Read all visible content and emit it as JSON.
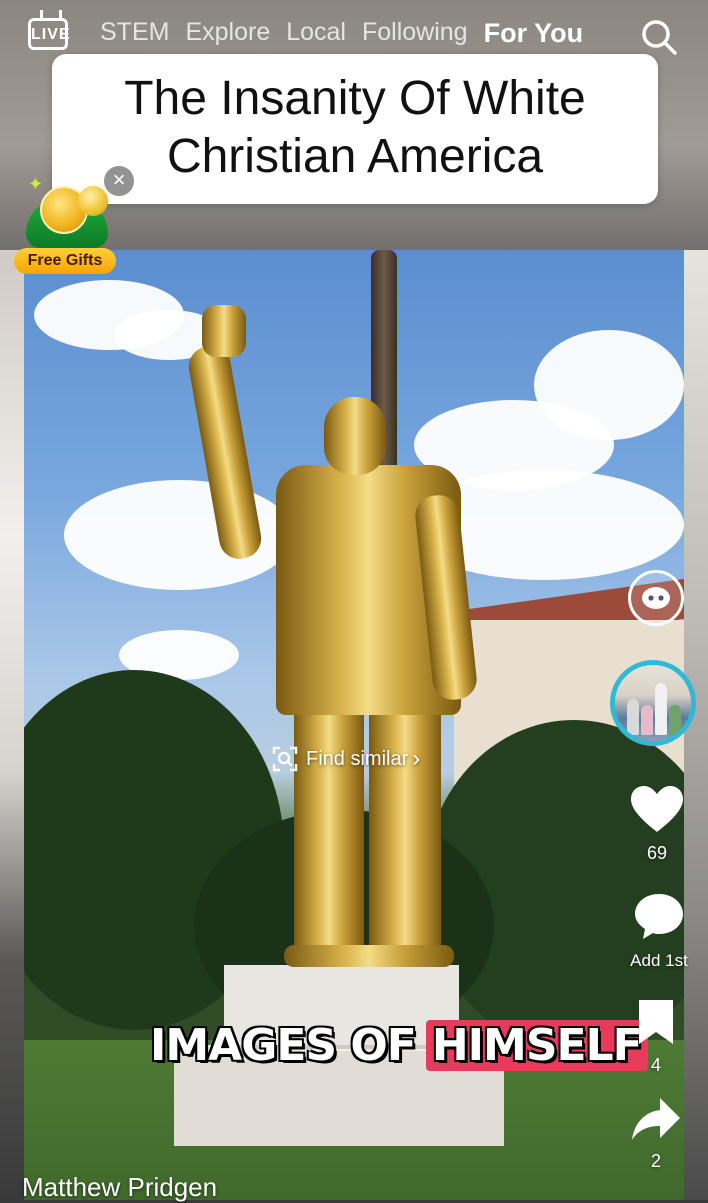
{
  "topnav": {
    "live_label": "LIVE",
    "tabs": [
      "STEM",
      "Explore",
      "Local",
      "Following",
      "For You"
    ],
    "active_tab": "For You"
  },
  "caption": {
    "line1": "The Insanity Of White",
    "line2": "Christian America"
  },
  "promo": {
    "label": "Free Gifts",
    "close_glyph": "×"
  },
  "find_similar": {
    "label": "Find similar",
    "chevron": "›"
  },
  "subtitle": {
    "plain": "IMAGES OF",
    "highlight": "HIMSELF"
  },
  "rail": {
    "likes": "69",
    "comments": "Add 1st",
    "bookmarks": "4",
    "shares": "2"
  },
  "author": {
    "name": "Matthew Pridgen"
  },
  "colors": {
    "highlight": "#e83a5a",
    "avatar_ring": "#2fb9d4",
    "promo_badge": "#ffcf3a"
  }
}
